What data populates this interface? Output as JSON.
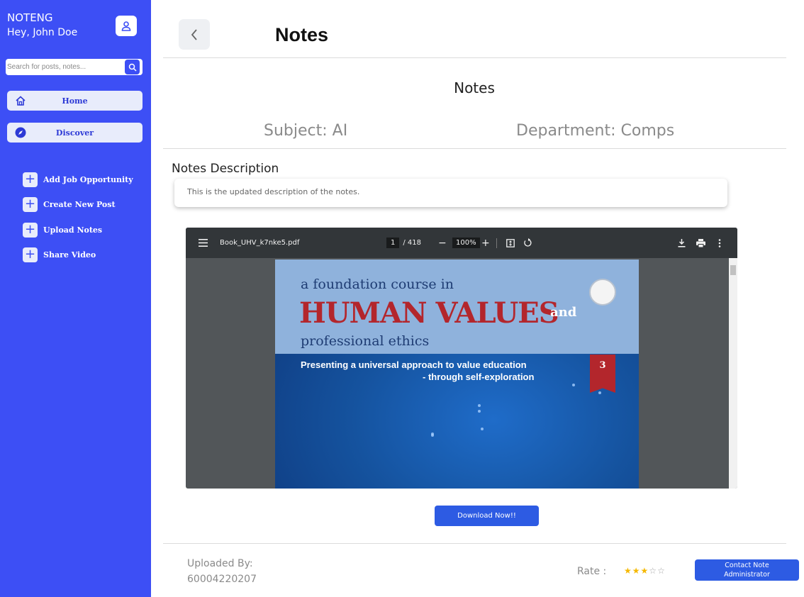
{
  "sidebar": {
    "brand": "NOTENG",
    "greeting": "Hey, John Doe",
    "search_placeholder": "Search for posts, notes...",
    "nav": [
      {
        "label": "Home",
        "icon": "home-icon"
      },
      {
        "label": "Discover",
        "icon": "compass-icon"
      }
    ],
    "actions": [
      {
        "label": "Add Job Opportunity"
      },
      {
        "label": "Create New Post"
      },
      {
        "label": "Upload Notes"
      },
      {
        "label": "Share Video"
      }
    ]
  },
  "header": {
    "title": "Notes"
  },
  "note": {
    "title": "Notes",
    "subject": "Subject: AI",
    "department": "Department: Comps",
    "description_label": "Notes Description",
    "description": "This is the updated description of the notes."
  },
  "pdf_viewer": {
    "filename": "Book_UHV_k7nke5.pdf",
    "current_page": "1",
    "total_pages": "/ 418",
    "zoom": "100%",
    "cover": {
      "line1": "a foundation course in",
      "line2": "HUMAN VALUES",
      "line2b": "and",
      "line3": "professional ethics",
      "tagline1": "Presenting a universal approach to value education",
      "tagline2": "- through self-exploration",
      "edition": "3"
    }
  },
  "download_label": "Download Now!!",
  "footer": {
    "uploaded_label": "Uploaded By:",
    "uploaded_value": "60004220207",
    "rate_label": "Rate :",
    "rating": 3,
    "rating_max": 5,
    "contact_label_line1": "Contact Note",
    "contact_label_line2": "Administrator"
  },
  "colors": {
    "sidebar": "#3d4ff5",
    "primary_button": "#2d5be3",
    "star": "#f5b800"
  }
}
